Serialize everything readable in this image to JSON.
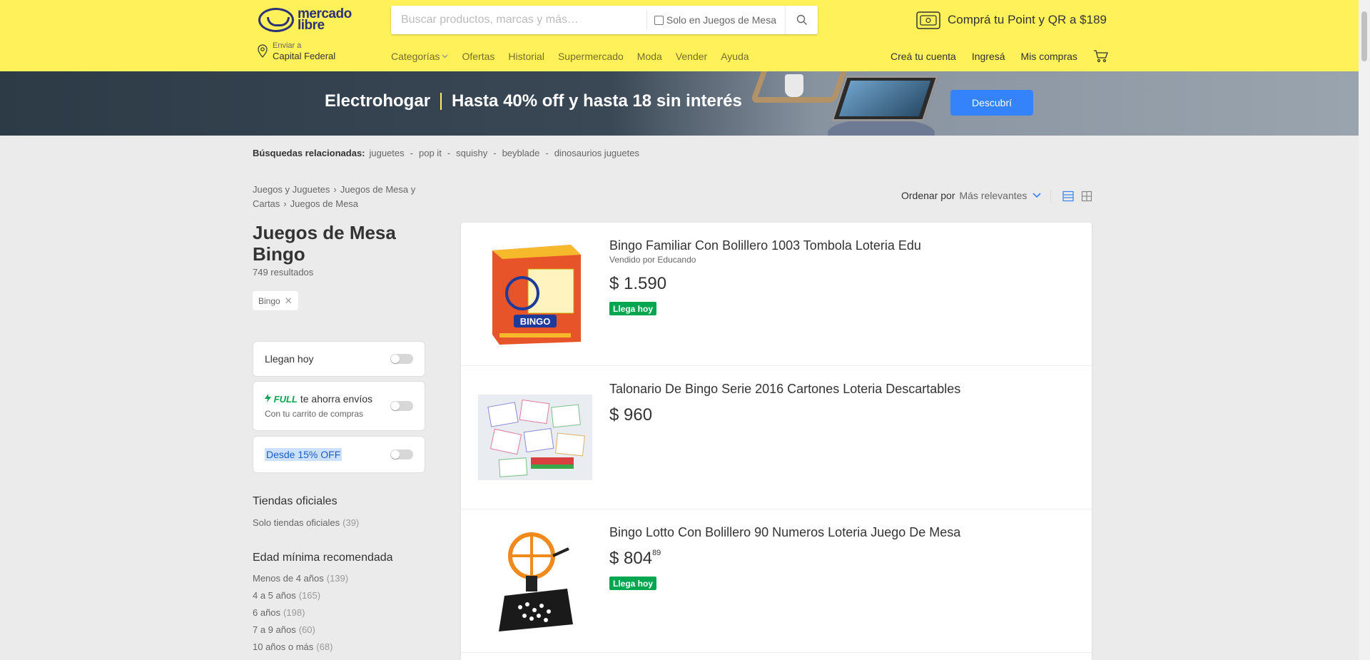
{
  "header": {
    "logo": {
      "line1": "mercado",
      "line2": "libre"
    },
    "search": {
      "placeholder": "Buscar productos, marcas y más…",
      "checkbox_label": "Solo en Juegos de Mesa"
    },
    "promo": "Comprá tu Point y QR a $189",
    "location": {
      "label": "Enviar a",
      "value": "Capital Federal"
    },
    "nav": [
      "Categorías",
      "Ofertas",
      "Historial",
      "Supermercado",
      "Moda",
      "Vender",
      "Ayuda"
    ],
    "user_nav": [
      "Creá tu cuenta",
      "Ingresá",
      "Mis compras"
    ]
  },
  "banner": {
    "brand": "Electrohogar",
    "offer": "Hasta 40% off y hasta 18 sin interés",
    "button": "Descubrí"
  },
  "related": {
    "label": "Búsquedas relacionadas:",
    "items": [
      "juguetes",
      "pop it",
      "squishy",
      "beyblade",
      "dinosaurios juguetes"
    ]
  },
  "breadcrumb": [
    "Juegos y Juguetes",
    "Juegos de Mesa y Cartas",
    "Juegos de Mesa"
  ],
  "page": {
    "title": "Juegos de Mesa Bingo",
    "results": "749 resultados",
    "chip": "Bingo"
  },
  "filters": {
    "llegan_hoy": "Llegan hoy",
    "full_tag": "FULL",
    "full_label": "te ahorra envíos",
    "full_sub": "Con tu carrito de compras",
    "discount": "Desde 15% OFF"
  },
  "tiendas": {
    "title": "Tiendas oficiales",
    "link": "Solo tiendas oficiales",
    "count": "(39)"
  },
  "edad": {
    "title": "Edad mínima recomendada",
    "items": [
      {
        "label": "Menos de 4 años",
        "count": "(139)"
      },
      {
        "label": "4 a 5 años",
        "count": "(165)"
      },
      {
        "label": "6 años",
        "count": "(198)"
      },
      {
        "label": "7 a 9 años",
        "count": "(60)"
      },
      {
        "label": "10 años o más",
        "count": "(68)"
      }
    ]
  },
  "order": {
    "label": "Ordenar por",
    "value": "Más relevantes"
  },
  "products": [
    {
      "title": "Bingo Familiar Con Bolillero 1003 Tombola Loteria Edu",
      "seller": "Vendido por Educando",
      "price": "$ 1.590",
      "cents": "",
      "badge": "Llega hoy"
    },
    {
      "title": "Talonario De Bingo Serie 2016 Cartones Loteria Descartables",
      "seller": "",
      "price": "$ 960",
      "cents": "",
      "badge": ""
    },
    {
      "title": "Bingo Lotto Con Bolillero 90 Numeros Loteria Juego De Mesa",
      "seller": "",
      "price": "$ 804",
      "cents": "89",
      "badge": "Llega hoy"
    }
  ],
  "colors": {
    "yellow": "#fff159",
    "blue": "#3483fa",
    "green": "#00a650"
  }
}
